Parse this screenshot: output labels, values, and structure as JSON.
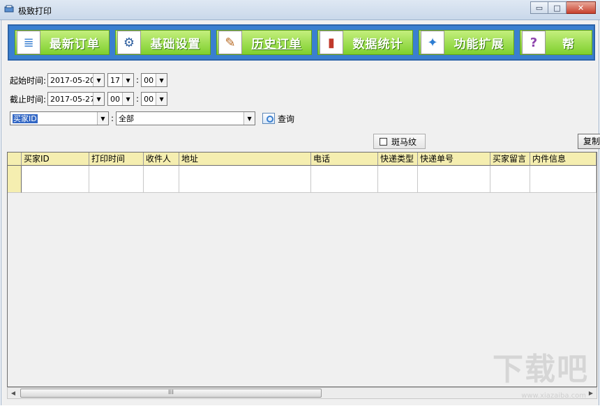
{
  "window": {
    "title": "极致打印",
    "min": "▭",
    "max": "□",
    "close": "✕"
  },
  "toolbar": [
    {
      "label": "最新订单",
      "icon": "document-list-icon",
      "glyph": "≣"
    },
    {
      "label": "基础设置",
      "icon": "gear-icon",
      "glyph": "⚙"
    },
    {
      "label": "历史订单",
      "icon": "pencil-icon",
      "glyph": "✎"
    },
    {
      "label": "数据统计",
      "icon": "bar-chart-icon",
      "glyph": "▮"
    },
    {
      "label": "功能扩展",
      "icon": "puzzle-icon",
      "glyph": "✦"
    },
    {
      "label": "帮",
      "icon": "help-icon",
      "glyph": "?"
    }
  ],
  "filters": {
    "start_label": "起始时间:",
    "start_date": "2017-05-20",
    "start_hour": "17",
    "start_min": "00",
    "end_label": "截止时间:",
    "end_date": "2017-05-27",
    "end_hour": "00",
    "end_min": "00",
    "colon": ":",
    "field_select": "买家ID",
    "field_value": "全部",
    "query_label": "查询"
  },
  "options": {
    "stripe_label": "斑马纹",
    "copy_label": "复制"
  },
  "grid": {
    "columns": [
      "买家ID",
      "打印时间",
      "收件人",
      "地址",
      "电话",
      "快递类型",
      "快递单号",
      "买家留言",
      "内件信息"
    ]
  },
  "scrollbar": {
    "left_arrow": "◀",
    "right_arrow": "▶",
    "grip": "III"
  },
  "watermark": {
    "text": "下载吧",
    "sub": "www.xiazaiba.com"
  }
}
